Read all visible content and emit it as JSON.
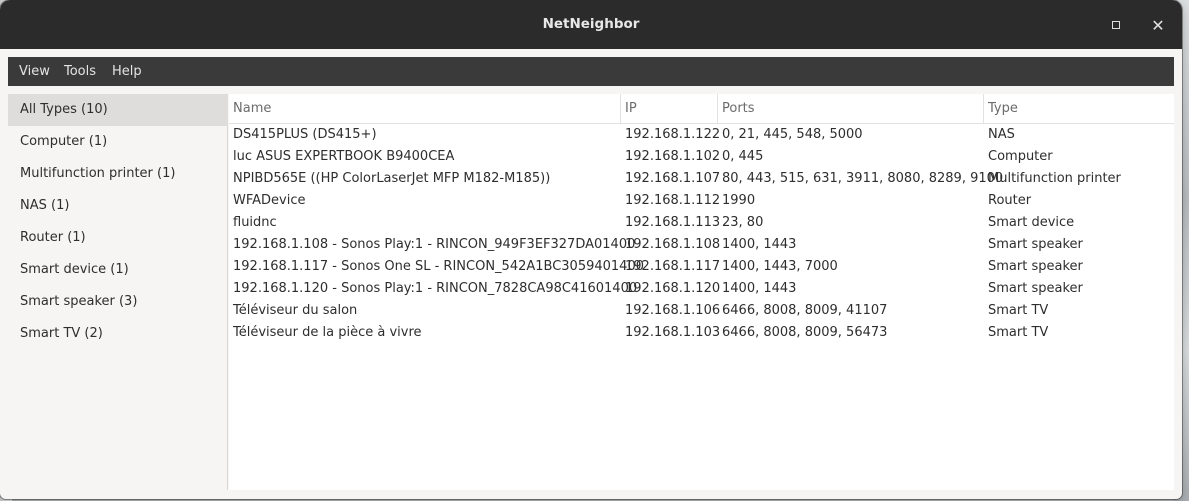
{
  "window": {
    "title": "NetNeighbor",
    "maximize_glyph": "maximize-icon",
    "close_glyph": "✕"
  },
  "menu": [
    "View",
    "Tools",
    "Help"
  ],
  "sidebar": {
    "items": [
      "All Types (10)",
      "Computer (1)",
      "Multifunction printer (1)",
      "NAS (1)",
      "Router (1)",
      "Smart device (1)",
      "Smart speaker (3)",
      "Smart TV (2)"
    ],
    "selected_index": 0
  },
  "table": {
    "columns": [
      "Name",
      "IP",
      "Ports",
      "Type"
    ],
    "rows": [
      [
        "DS415PLUS (DS415+)",
        "192.168.1.122",
        "0, 21, 445, 548, 5000",
        "NAS"
      ],
      [
        "luc ASUS EXPERTBOOK B9400CEA",
        "192.168.1.102",
        "0, 445",
        "Computer"
      ],
      [
        "NPIBD565E ((HP ColorLaserJet MFP M182-M185))",
        "192.168.1.107",
        "80, 443, 515, 631, 3911, 8080, 8289, 9100",
        "Multifunction printer"
      ],
      [
        "WFADevice",
        "192.168.1.112",
        "1990",
        "Router"
      ],
      [
        "fluidnc",
        "192.168.1.113",
        "23, 80",
        "Smart device"
      ],
      [
        "192.168.1.108 - Sonos Play:1 - RINCON_949F3EF327DA01400",
        "192.168.1.108",
        "1400, 1443",
        "Smart speaker"
      ],
      [
        "192.168.1.117 - Sonos One SL - RINCON_542A1BC3059401400",
        "192.168.1.117",
        "1400, 1443, 7000",
        "Smart speaker"
      ],
      [
        "192.168.1.120 - Sonos Play:1 - RINCON_7828CA98C41601400",
        "192.168.1.120",
        "1400, 1443",
        "Smart speaker"
      ],
      [
        "Téléviseur du salon",
        "192.168.1.106",
        "6466, 8008, 8009, 41107",
        "Smart TV"
      ],
      [
        "Téléviseur de la pièce à vivre",
        "192.168.1.103",
        "6466, 8008, 8009, 56473",
        "Smart TV"
      ]
    ]
  }
}
